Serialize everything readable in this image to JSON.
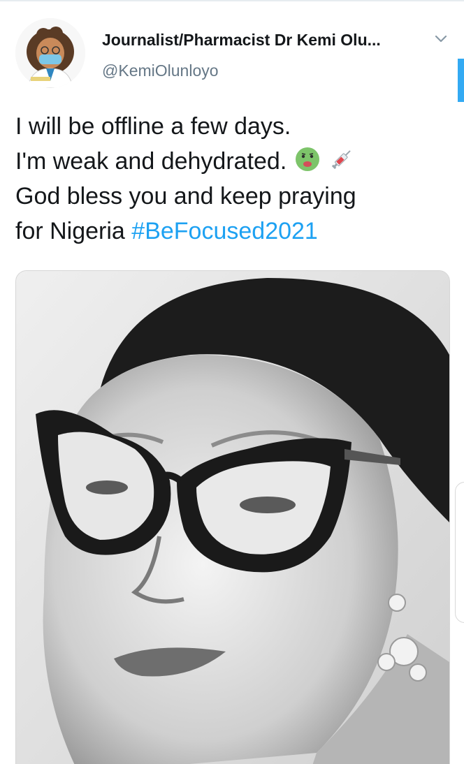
{
  "tweet": {
    "display_name": "Journalist/Pharmacist Dr Kemi Olu...",
    "handle": "@KemiOlunloyo",
    "text_lines": [
      "I will be offline a few days.",
      "I'm weak and dehydrated.",
      "God bless you and keep praying",
      "for Nigeria"
    ],
    "hashtag": "#BeFocused2021",
    "emojis": [
      "nauseated-face-emoji",
      "syringe-emoji"
    ]
  },
  "icons": {
    "caret": "chevron-down-icon"
  },
  "colors": {
    "text": "#14171a",
    "secondary": "#657786",
    "link": "#1da1f2"
  }
}
